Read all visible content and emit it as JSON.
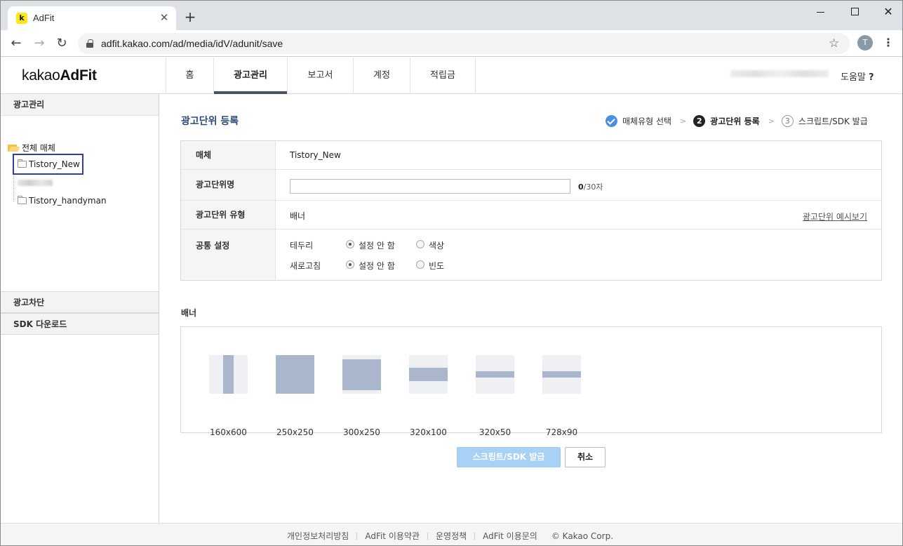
{
  "browser": {
    "tab_title": "AdFit",
    "favicon_letter": "k",
    "url": "adfit.kakao.com/ad/media/idV/adunit/save",
    "profile_initial": "T"
  },
  "header": {
    "logo_light": "kakao",
    "logo_bold": "AdFit",
    "nav": [
      "홈",
      "광고관리",
      "보고서",
      "계정",
      "적립금"
    ],
    "active_nav": "광고관리",
    "help_label": "도움말",
    "help_mark": "?"
  },
  "sidebar": {
    "title": "광고관리",
    "tree": {
      "root": "전체 매체",
      "items": [
        "Tistory_New",
        "Tistory_handyman"
      ]
    },
    "sections": [
      "광고차단",
      "SDK 다운로드"
    ]
  },
  "main": {
    "page_title": "광고단위 등록",
    "steps": [
      {
        "label": "매체유형 선택",
        "number": "",
        "state": "done"
      },
      {
        "label": "광고단위 등록",
        "number": "2",
        "state": "current"
      },
      {
        "label": "스크립트/SDK 발급",
        "number": "3",
        "state": "next"
      }
    ],
    "form": {
      "media_label": "매체",
      "media_value": "Tistory_New",
      "name_label": "광고단위명",
      "name_value": "",
      "name_count": "0",
      "name_limit": "/30자",
      "type_label": "광고단위 유형",
      "type_value": "배너",
      "preview_link": "광고단위 예시보기",
      "common_label": "공통 설정",
      "border_label": "테두리",
      "border_options": [
        "설정 안 함",
        "색상"
      ],
      "border_selected": "설정 안 함",
      "refresh_label": "새로고침",
      "refresh_options": [
        "설정 안 함",
        "빈도"
      ],
      "refresh_selected": "설정 안 함"
    },
    "banner_title": "배너",
    "banner_sizes": [
      "160x600",
      "250x250",
      "300x250",
      "320x100",
      "320x50",
      "728x90"
    ],
    "issue_button": "스크립트/SDK 발급",
    "cancel_button": "취소"
  },
  "footer": {
    "links": [
      "개인정보처리방침",
      "AdFit 이용약관",
      "운영정책",
      "AdFit 이용문의"
    ],
    "copyright": "© Kakao Corp."
  },
  "colors": {
    "accent": "#4a90e2",
    "title": "#2f4a7a",
    "issue_button": "#a7d1f5",
    "banner_thumb": "#a9b6cc",
    "selection_box": "#2e3fa3"
  }
}
